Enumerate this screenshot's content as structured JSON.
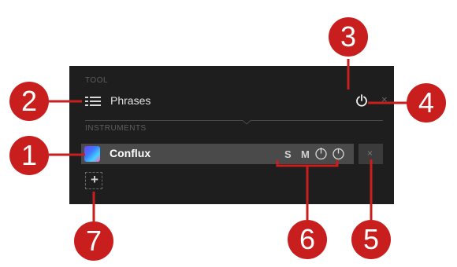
{
  "panel": {
    "tool_section_label": "TOOL",
    "tool": {
      "name": "Phrases",
      "icon": "phrases-icon",
      "power_icon": "power-icon",
      "close_symbol": "×"
    },
    "instruments_section_label": "INSTRUMENTS",
    "instrument": {
      "name": "Conflux",
      "solo_label": "S",
      "mute_label": "M",
      "close_symbol": "×"
    },
    "add_symbol": "+"
  },
  "callouts": [
    "1",
    "2",
    "3",
    "4",
    "5",
    "6",
    "7"
  ],
  "colors": {
    "panel_background": "#1e1e1e",
    "instrument_row": "#4a4a4a",
    "callout_red": "#c81e1e"
  }
}
